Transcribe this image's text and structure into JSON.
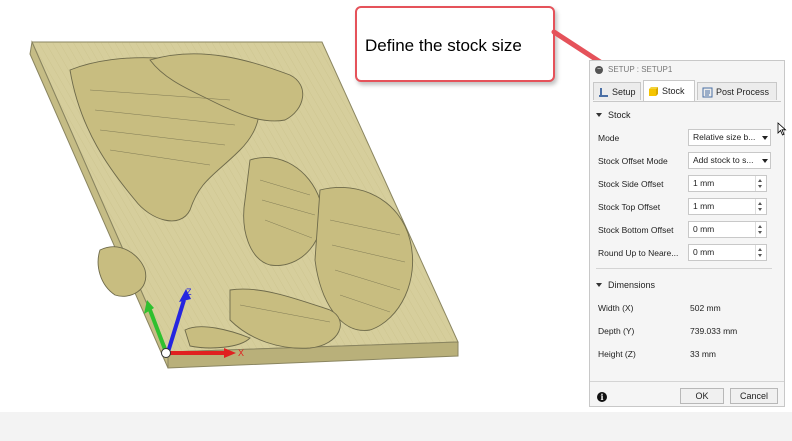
{
  "callout": {
    "text": "Define the stock size"
  },
  "dialog": {
    "title": "SETUP : SETUP1",
    "tabs": [
      {
        "label": "Setup",
        "icon": "setup-icon"
      },
      {
        "label": "Stock",
        "icon": "stock-icon"
      },
      {
        "label": "Post Process",
        "icon": "post-process-icon"
      }
    ],
    "active_tab": "Stock",
    "stock": {
      "header": "Stock",
      "mode": {
        "label": "Mode",
        "value": "Relative size b..."
      },
      "offset_mode": {
        "label": "Stock Offset Mode",
        "value": "Add stock to s..."
      },
      "side_offset": {
        "label": "Stock Side Offset",
        "value": "1 mm"
      },
      "top_offset": {
        "label": "Stock Top Offset",
        "value": "1 mm"
      },
      "bottom_offset": {
        "label": "Stock Bottom Offset",
        "value": "0 mm"
      },
      "round_up": {
        "label": "Round Up to Neare...",
        "value": "0 mm"
      }
    },
    "dimensions": {
      "header": "Dimensions",
      "width": {
        "label": "Width (X)",
        "value": "502 mm"
      },
      "depth": {
        "label": "Depth (Y)",
        "value": "739.033 mm"
      },
      "height": {
        "label": "Height (Z)",
        "value": "33 mm"
      }
    },
    "ok_label": "OK",
    "cancel_label": "Cancel"
  },
  "viewport": {
    "axis_labels": {
      "x": "X",
      "z": "Z"
    },
    "colors": {
      "stock": "#d4cc99",
      "x_axis": "#e02020",
      "y_axis": "#2fc02f",
      "z_axis": "#2525e0",
      "callout_border": "#e5525a"
    }
  }
}
